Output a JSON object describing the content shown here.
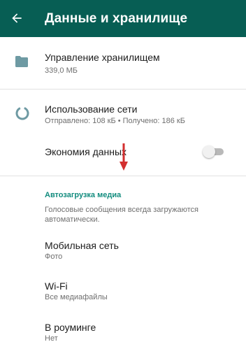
{
  "appbar": {
    "title": "Данные и хранилище",
    "back_icon": "arrow-back-icon",
    "background": "#075e54"
  },
  "storage": {
    "icon": "folder-icon",
    "title": "Управление хранилищем",
    "subtitle": "339,0 МБ"
  },
  "network": {
    "icon": "network-usage-icon",
    "title": "Использование сети",
    "subtitle": "Отправлено: 108 кБ • Получено: 186 кБ"
  },
  "data_saver": {
    "title": "Экономия данных",
    "enabled": false
  },
  "annotation": {
    "icon": "red-down-arrow-icon",
    "color": "#d32f2f"
  },
  "media_autodownload": {
    "header": "Автозагрузка медиа",
    "description": "Голосовые сообщения всегда загружаются автоматически.",
    "accent": "#128c7e",
    "items": [
      {
        "title": "Мобильная сеть",
        "subtitle": "Фото"
      },
      {
        "title": "Wi-Fi",
        "subtitle": "Все медиафайлы"
      },
      {
        "title": "В роуминге",
        "subtitle": "Нет"
      }
    ]
  }
}
